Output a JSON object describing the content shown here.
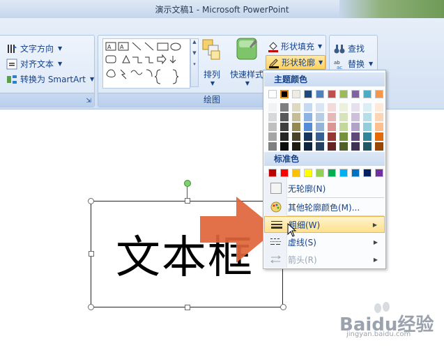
{
  "window": {
    "title": "演示文稿1 - Microsoft PowerPoint"
  },
  "ribbon": {
    "paragraph_partial": {
      "text_direction": "文字方向",
      "align_text": "对齐文本",
      "convert_smartart": "转换为 SmartArt"
    },
    "drawing": {
      "label": "绘图",
      "arrange_label": "排列",
      "quick_styles_label": "快速样式",
      "shape_fill_label": "形状填充",
      "shape_outline_label": "形状轮廓"
    },
    "editing_partial": {
      "find_label": "查找",
      "replace_label": "替换"
    }
  },
  "outline_menu": {
    "theme_colors_header": "主题颜色",
    "standard_colors_header": "标准色",
    "theme_colors_top": [
      "#ffffff",
      "#000000",
      "#eeece1",
      "#1f497d",
      "#4f81bd",
      "#c0504d",
      "#9bbb59",
      "#8064a2",
      "#4bacc6",
      "#f79646"
    ],
    "theme_colors_shades": [
      [
        "#f2f2f2",
        "#d8d8d8",
        "#bfbfbf",
        "#a5a5a5",
        "#7f7f7f"
      ],
      [
        "#7f7f7f",
        "#595959",
        "#3f3f3f",
        "#262626",
        "#0c0c0c"
      ],
      [
        "#ddd9c3",
        "#c4bd97",
        "#938953",
        "#494429",
        "#1d1b10"
      ],
      [
        "#c6d9f0",
        "#8db3e2",
        "#548dd4",
        "#17365d",
        "#0f243e"
      ],
      [
        "#dbe5f1",
        "#b8cce4",
        "#95b3d7",
        "#366092",
        "#244061"
      ],
      [
        "#f2dcdb",
        "#e5b9b7",
        "#d99694",
        "#953734",
        "#632423"
      ],
      [
        "#ebf1dd",
        "#d7e3bc",
        "#c3d69b",
        "#76923c",
        "#4f6128"
      ],
      [
        "#e5e0ec",
        "#ccc1d9",
        "#b2a2c7",
        "#5f497a",
        "#3f3151"
      ],
      [
        "#dbeef3",
        "#b7dde8",
        "#92cddc",
        "#31859b",
        "#205867"
      ],
      [
        "#fdeada",
        "#fbd5b5",
        "#fac08f",
        "#e36c09",
        "#974806"
      ]
    ],
    "standard_colors": [
      "#c00000",
      "#ff0000",
      "#ffc000",
      "#ffff00",
      "#92d050",
      "#00b050",
      "#00b0f0",
      "#0070c0",
      "#002060",
      "#7030a0"
    ],
    "items": {
      "no_outline": "无轮廓(N)",
      "more_colors": "其他轮廓颜色(M)...",
      "weight": "粗细(W)",
      "dashes": "虚线(S)",
      "arrows": "箭头(R)"
    }
  },
  "slide": {
    "textbox_text": "文本框"
  },
  "watermark": {
    "brand": "Baidu经验",
    "url": "jingyan.baidu.com"
  }
}
